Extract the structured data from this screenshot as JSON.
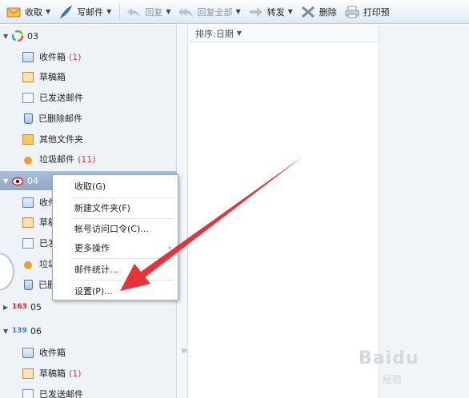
{
  "toolbar": {
    "receive": "收取",
    "compose": "写邮件",
    "reply": "回复",
    "reply_all": "回复全部",
    "forward": "转发",
    "delete": "删除",
    "print": "打印预"
  },
  "accounts": [
    {
      "name": "03",
      "folders": [
        {
          "label": "收件箱",
          "count": "(1)"
        },
        {
          "label": "草稿箱",
          "count": ""
        },
        {
          "label": "已发送邮件",
          "count": ""
        },
        {
          "label": "已删除邮件",
          "count": ""
        },
        {
          "label": "其他文件夹",
          "count": ""
        },
        {
          "label": "垃圾邮件",
          "count": "(11)"
        }
      ]
    },
    {
      "name": "04",
      "folders": [
        {
          "label": "收件箱",
          "count": ""
        },
        {
          "label": "草稿箱",
          "count": ""
        },
        {
          "label": "已发送邮件",
          "count": ""
        },
        {
          "label": "垃圾邮件",
          "count": ""
        },
        {
          "label": "已删除邮件",
          "count": ""
        }
      ],
      "folders_visible": [
        "收件",
        "草稿",
        "已发",
        "垃圾",
        "已删"
      ]
    },
    {
      "name": "05",
      "logo_text": "163",
      "folders": []
    },
    {
      "name": "06",
      "logo_text": "139",
      "folders": [
        {
          "label": "收件箱",
          "count": ""
        },
        {
          "label": "草稿箱",
          "count": "(1)"
        },
        {
          "label": "已发送邮件",
          "count": ""
        }
      ]
    }
  ],
  "list": {
    "sort_label": "排序:日期"
  },
  "context_menu": {
    "items": [
      "收取(G)",
      "新建文件夹(F)",
      "帐号访问口令(C)...",
      "更多操作",
      "邮件统计...",
      "设置(P)..."
    ]
  },
  "watermark": {
    "brand": "Baidu",
    "sub": "经验"
  },
  "colors": {
    "accent_arrow": "#e8323a",
    "unread_count": "#e03b3b",
    "selected_account": "#8ea9c7"
  }
}
